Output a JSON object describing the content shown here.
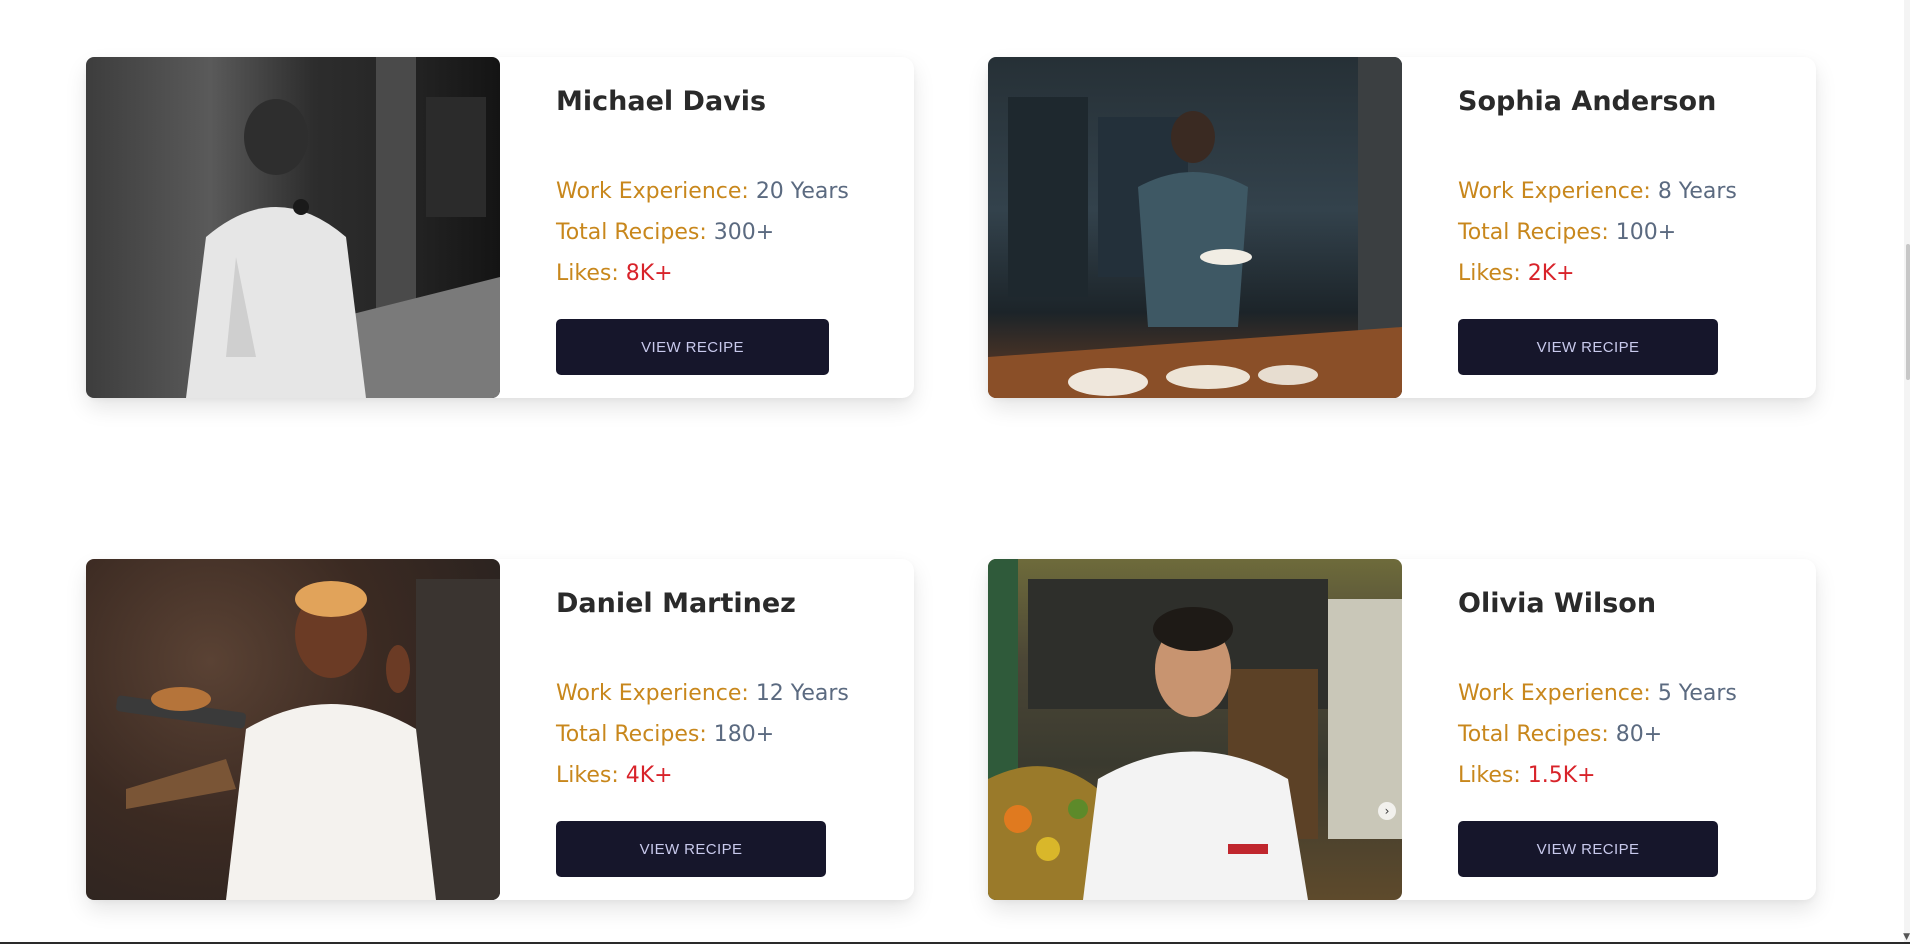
{
  "chefs": [
    {
      "name": "Michael Davis",
      "experience_label": "Work Experience:",
      "experience_value": "20 Years",
      "recipes_label": "Total Recipes:",
      "recipes_value": "300+",
      "likes_label": "Likes:",
      "likes_value": "8K+",
      "button_label": "VIEW RECIPE"
    },
    {
      "name": "Sophia Anderson",
      "experience_label": "Work Experience:",
      "experience_value": "8 Years",
      "recipes_label": "Total Recipes:",
      "recipes_value": "100+",
      "likes_label": "Likes:",
      "likes_value": "2K+",
      "button_label": "VIEW RECIPE"
    },
    {
      "name": "Daniel Martinez",
      "experience_label": "Work Experience:",
      "experience_value": "12 Years",
      "recipes_label": "Total Recipes:",
      "recipes_value": "180+",
      "likes_label": "Likes:",
      "likes_value": "4K+",
      "button_label": "VIEW RECIPE"
    },
    {
      "name": "Olivia Wilson",
      "experience_label": "Work Experience:",
      "experience_value": "5 Years",
      "recipes_label": "Total Recipes:",
      "recipes_value": "80+",
      "likes_label": "Likes:",
      "likes_value": "1.5K+",
      "button_label": "VIEW RECIPE"
    }
  ],
  "colors": {
    "label": "#c8871c",
    "value": "#5b6a80",
    "likes_value": "#d8232a",
    "button_bg": "#16162b",
    "button_text": "#c8c9ec",
    "name": "#2a2a2a"
  },
  "icons": {
    "photo_next": "chevron-right-icon"
  }
}
